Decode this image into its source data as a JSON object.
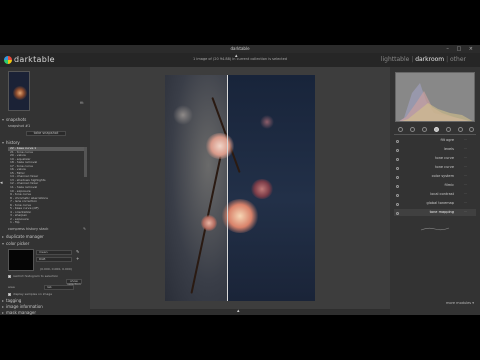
{
  "window": {
    "title": "darktable",
    "buttons": "– □ ×"
  },
  "header": {
    "brand": "darktable",
    "status": "1 image of (20 94.88) in current collection is selected",
    "views": {
      "lighttable": "lighttable",
      "sep": "|",
      "darkroom": "darkroom",
      "other": "other"
    }
  },
  "left": {
    "zoom": "fit",
    "snapshots": {
      "label": "snapshots",
      "item": "snapshot #1",
      "take_button": "take snapshot"
    },
    "history": {
      "label": "history",
      "items": [
        "22 - base curve 1",
        "21 - tone curve",
        "20 - velvia",
        "19 - equalizer",
        "18 - haze removal",
        "17 - tone curve",
        "16 - velvia",
        "15 - filmic",
        "14 - channel mixer",
        "13 - shadows highlights",
        "12 - channel mixer",
        "11 - haze removal",
        "10 - exposure",
        "9 - tone curve",
        "8 - chromatic aberrations",
        "7 - lens correction",
        "6 - tone curve",
        "5 - base curve (off)",
        "4 - orientation",
        "3 - sharpen",
        "2 - exposure",
        "1 - flip"
      ],
      "compress_button": "compress history stack"
    },
    "duplicate_manager": "duplicate manager",
    "color_picker": {
      "label": "color picker",
      "mode": "mean",
      "space": "RGB",
      "values": "(0.000, 0.000, 0.000)",
      "restrict_label": "restrict histogram to selection",
      "restrict_button": "show selection",
      "area_label": "area",
      "area_value": "lab",
      "display_label": "display samples on image"
    },
    "tagging": "tagging",
    "image_information": "image information",
    "mask_manager": "mask manager"
  },
  "right": {
    "modules": [
      {
        "name": "filt ogre",
        "active": false
      },
      {
        "name": "levels",
        "active": false
      },
      {
        "name": "tone curve",
        "active": false
      },
      {
        "name": "tone curve",
        "active": false
      },
      {
        "name": "color system",
        "active": false
      },
      {
        "name": "filmic",
        "active": false
      },
      {
        "name": "local contrast",
        "active": false
      },
      {
        "name": "global tonemap",
        "active": false
      },
      {
        "name": "tone mapping",
        "active": true
      }
    ],
    "more_modules": "more modules ▾"
  }
}
